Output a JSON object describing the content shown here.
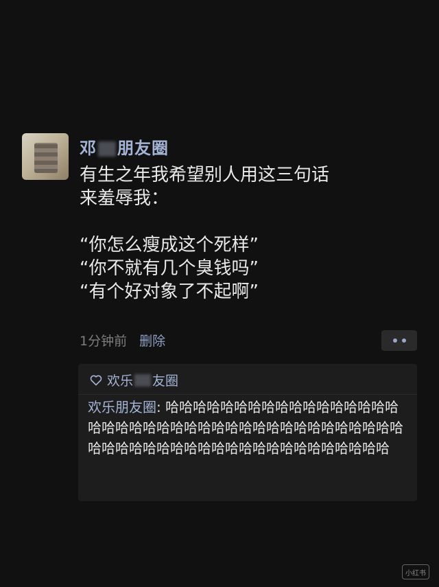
{
  "post": {
    "username_prefix": "邓",
    "username_suffix": "朋友圈",
    "text": "有生之年我希望别人用这三句话\n来羞辱我：\n\n“你怎么瘦成这个死样”\n“你不就有几个臭钱吗”\n“有个好对象了不起啊”",
    "time": "1分钟前",
    "delete_label": "删除"
  },
  "comments_section": {
    "likes_prefix": "欢乐",
    "likes_suffix": "友圈",
    "comment": {
      "author": "欢乐朋友圈",
      "separator": ": ",
      "text": "哈哈哈哈哈哈哈哈哈哈哈哈哈哈哈哈哈哈哈哈哈哈哈哈哈哈哈哈哈哈哈哈哈哈哈哈哈哈哈哈哈哈哈哈哈哈哈哈哈哈哈哈哈哈哈哈哈哈哈哈哈哈"
    }
  },
  "watermark": "小红书",
  "icons": {
    "more": "more-dots-icon",
    "like": "heart-outline-icon"
  },
  "colors": {
    "background": "#111111",
    "link_blue": "#a4b4d6",
    "text": "#e9e9e9",
    "meta_gray": "#7d7d7d",
    "comment_bg": "#1d1d1d"
  }
}
